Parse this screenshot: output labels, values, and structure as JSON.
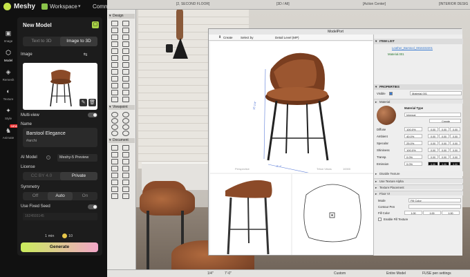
{
  "app": {
    "brand": "Meshy",
    "workspace_label": "Workspace",
    "comm_label": "Comm"
  },
  "rail": [
    {
      "label": "Image",
      "icon": "image-icon"
    },
    {
      "label": "Model",
      "icon": "cube-icon"
    },
    {
      "label": "Remesh",
      "icon": "remesh-icon"
    },
    {
      "label": "Texture",
      "icon": "texture-icon"
    },
    {
      "label": "Style",
      "icon": "style-icon"
    },
    {
      "label": "Animate",
      "icon": "animate-icon",
      "badge": "NEW"
    }
  ],
  "panel": {
    "title": "New Model",
    "tabs": [
      "Text to 3D",
      "Image to 3D"
    ],
    "active_tab": "Image to 3D",
    "image_label": "Image",
    "multiview_label": "Multi-view",
    "name_label": "Name",
    "name_value": "Barstool Elegance",
    "tag_value": "#archi",
    "ai_model_label": "AI Model",
    "ai_model_value": "Meshy-5 Preview",
    "license_label": "License",
    "license_options": [
      "CC BY 4.0",
      "Private"
    ],
    "symmetry_label": "Symmetry",
    "symmetry_options": [
      "Off",
      "Auto",
      "On"
    ],
    "fixed_seed_label": "Use Fixed Seed",
    "seed_value": "1624593145",
    "credits_text": "1 min",
    "credits_cost": "10",
    "generate_label": "Generate"
  },
  "topbar": {
    "floor": "[2, SECOND FLOOR]",
    "view": "[3D / All]",
    "action": "[Action Center]",
    "interior": "[INTERIOR DESIG"
  },
  "toolbox": {
    "design": "Design",
    "viewpoint": "Viewpoint",
    "document": "Document"
  },
  "modelport": {
    "title": "ModelPort",
    "create_label": "Create",
    "select_by_label": "Select by",
    "detail_level_label": "Detail Level (MP)",
    "dim_height": "35 1/4\"",
    "dim_width": "2'-1\"",
    "vp_label_left": "Perspective",
    "vp_label_right": "Triton Views",
    "vp_scale": "10000"
  },
  "props": {
    "item_list_label": "ITEM LIST",
    "item_name": "Leather_Barstool_0816332201",
    "item_material": "Material.001",
    "properties_label": "PROPERTIES",
    "visible_label": "Visible",
    "material_name": "Material.001",
    "material_section": "Material",
    "material_type_label": "Material Type",
    "material_type_value": "Internal",
    "create_btn": "Create",
    "rows": [
      {
        "label": "Diffuse",
        "value": "100.0%"
      },
      {
        "label": "Ambient",
        "value": "40.0%"
      },
      {
        "label": "Specular",
        "value": "25.0%"
      },
      {
        "label": "Shininess",
        "value": "100.0%"
      },
      {
        "label": "Transp.",
        "value": "0.0%"
      },
      {
        "label": "Emission",
        "value": "0.0%"
      }
    ],
    "swatch_values": [
      "0.00",
      "0.00",
      "0.00"
    ],
    "disable_texture": "Disable Texture",
    "use_texture_alpha": "Use Texture Alpha",
    "texture_placement": "Texture Placement",
    "floor_vi": "Floor VI",
    "mode_label": "Mode",
    "mode_value": "Fill Color",
    "contour_pen": "Contour Pen",
    "fill_color": "Fill Color",
    "fill_vals": [
      "1.00",
      "1.00",
      "1.00"
    ],
    "enable_fill_texture": "Enable Fill Texture"
  },
  "status": {
    "zoom": "1/4\"",
    "size": "7'-0\"",
    "custom": "Custom",
    "model": "Entire Model",
    "pen": "FUSE pen settings"
  }
}
